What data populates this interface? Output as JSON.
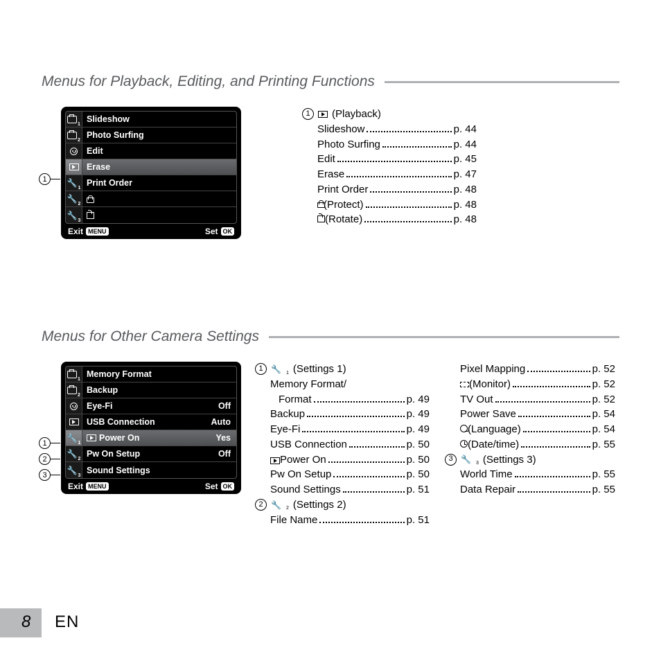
{
  "page": {
    "number": "8",
    "lang": "EN"
  },
  "section1": {
    "title": "Menus for Playback, Editing, and Printing Functions",
    "screen": {
      "rows": [
        {
          "icon": "camera1",
          "label": "Slideshow"
        },
        {
          "icon": "camera2",
          "label": "Photo Surfing"
        },
        {
          "icon": "face",
          "label": "Edit"
        },
        {
          "icon": "play",
          "label": "Erase",
          "selected": true
        },
        {
          "icon": "wrench1",
          "label": "Print Order"
        },
        {
          "icon": "wrench2",
          "label": "",
          "glyph": "protect"
        },
        {
          "icon": "wrench3",
          "label": "",
          "glyph": "rotate"
        }
      ],
      "footer": {
        "exit": "Exit",
        "menu": "MENU",
        "set": "Set",
        "ok": "OK"
      }
    },
    "callout": "1",
    "desc": {
      "head": {
        "num": "1",
        "icon": "play",
        "label": "(Playback)"
      },
      "items": [
        {
          "label": "Slideshow",
          "page": "p. 44"
        },
        {
          "label": "Photo Surfing",
          "page": "p. 44"
        },
        {
          "label": "Edit",
          "page": "p. 45"
        },
        {
          "label": "Erase",
          "page": "p. 47"
        },
        {
          "label": "Print Order",
          "page": "p. 48"
        },
        {
          "icon": "protect",
          "label": "(Protect)",
          "page": "p. 48"
        },
        {
          "icon": "rotate",
          "label": "(Rotate)",
          "page": "p. 48"
        }
      ]
    }
  },
  "section2": {
    "title": "Menus for Other Camera Settings",
    "screen": {
      "rows": [
        {
          "icon": "camera1",
          "label": "Memory Format"
        },
        {
          "icon": "camera2",
          "label": "Backup"
        },
        {
          "icon": "face",
          "label": "Eye-Fi",
          "val": "Off"
        },
        {
          "icon": "play",
          "label": "USB Connection",
          "val": "Auto"
        },
        {
          "icon": "wrench1",
          "label": "Power On",
          "labelIcon": "play",
          "val": "Yes",
          "selected": true
        },
        {
          "icon": "wrench2",
          "label": "Pw On Setup",
          "val": "Off"
        },
        {
          "icon": "wrench3",
          "label": "Sound Settings"
        }
      ],
      "footer": {
        "exit": "Exit",
        "menu": "MENU",
        "set": "Set",
        "ok": "OK"
      }
    },
    "callouts": [
      "1",
      "2",
      "3"
    ],
    "colA": [
      {
        "type": "head",
        "num": "1",
        "icon": "wrench1",
        "label": "(Settings 1)"
      },
      {
        "type": "wrap",
        "label1": "Memory Format/",
        "label2": "Format",
        "page": "p. 49"
      },
      {
        "label": "Backup",
        "page": "p. 49"
      },
      {
        "label": "Eye-Fi",
        "page": "p. 49"
      },
      {
        "label": "USB Connection",
        "page": "p. 50"
      },
      {
        "icon": "play",
        "label": "Power On",
        "page": "p. 50"
      },
      {
        "label": "Pw On Setup",
        "page": "p. 50"
      },
      {
        "label": "Sound Settings",
        "page": "p. 51"
      },
      {
        "type": "head",
        "num": "2",
        "icon": "wrench2",
        "label": "(Settings 2)"
      },
      {
        "label": "File Name",
        "page": "p. 51"
      }
    ],
    "colB": [
      {
        "label": "Pixel Mapping",
        "page": "p. 52"
      },
      {
        "icon": "monitor",
        "label": "(Monitor)",
        "page": "p. 52"
      },
      {
        "label": "TV Out",
        "page": "p. 52"
      },
      {
        "label": "Power Save",
        "page": "p. 54"
      },
      {
        "icon": "lang",
        "label": "(Language)",
        "page": "p. 54"
      },
      {
        "icon": "clock",
        "label": "(Date/time)",
        "page": "p. 55"
      },
      {
        "type": "head",
        "num": "3",
        "icon": "wrench3",
        "label": "(Settings 3)"
      },
      {
        "label": "World Time",
        "page": "p. 55"
      },
      {
        "label": "Data Repair",
        "page": "p. 55"
      }
    ]
  }
}
